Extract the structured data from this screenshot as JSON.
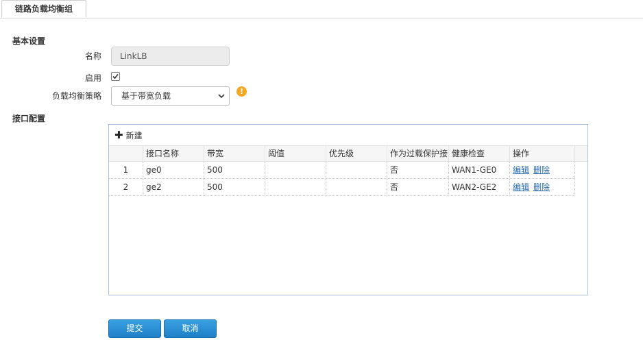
{
  "tab": {
    "label": "链路负载均衡组"
  },
  "basic": {
    "title": "基本设置",
    "name_label": "名称",
    "name_value": "LinkLB",
    "enable_label": "启用",
    "enable_checked": true,
    "strategy_label": "负载均衡策略",
    "strategy_value": "基于带宽负载"
  },
  "iface": {
    "title": "接口配置",
    "new_label": "新建",
    "columns": [
      "接口名称",
      "带宽",
      "阈值",
      "优先级",
      "作为过载保护接",
      "健康检查",
      "操作"
    ],
    "rows": [
      {
        "num": "1",
        "name": "ge0",
        "bandwidth": "500",
        "threshold": "",
        "priority": "",
        "overload": "否",
        "health": "WAN1-GE0",
        "edit": "编辑",
        "delete": "删除"
      },
      {
        "num": "2",
        "name": "ge2",
        "bandwidth": "500",
        "threshold": "",
        "priority": "",
        "overload": "否",
        "health": "WAN2-GE2",
        "edit": "编辑",
        "delete": "删除"
      }
    ]
  },
  "buttons": {
    "submit": "提交",
    "cancel": "取消"
  },
  "colors": {
    "accent": "#1f80c8",
    "warning": "#f5a623",
    "link": "#2a6db5"
  }
}
